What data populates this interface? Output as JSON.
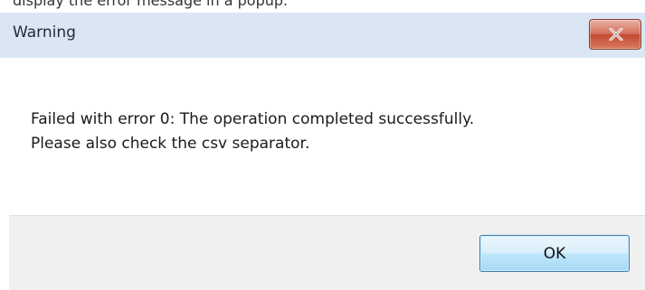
{
  "background_caption": "display the error message in a popup.",
  "dialog": {
    "title": "Warning",
    "close_icon": "close-x-icon",
    "message_line1": "Failed with error 0: The operation completed successfully.",
    "message_line2": " Please also check the csv separator.",
    "ok_label": "OK"
  },
  "colors": {
    "titlebar": "#dbe6f4",
    "close_button": "#c94a34",
    "footer": "#f0f0f0",
    "ok_button": "#bee6fd"
  }
}
